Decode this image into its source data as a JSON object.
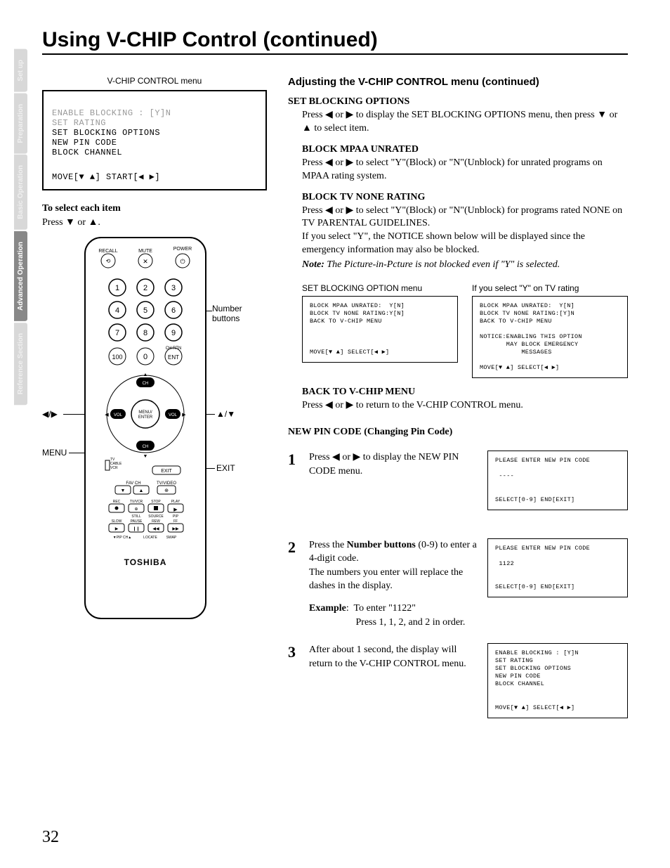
{
  "title": "Using V-CHIP Control (continued)",
  "page_number": "32",
  "side_tabs": [
    {
      "label": "Set up",
      "active": false
    },
    {
      "label": "Preparation",
      "active": false
    },
    {
      "label": "Basic Operation",
      "active": false
    },
    {
      "label": "Advanced Operation",
      "active": true
    },
    {
      "label": "Reference Section",
      "active": false
    }
  ],
  "left": {
    "menu_title": "V-CHIP CONTROL menu",
    "vchip_menu": {
      "line1": "ENABLE BLOCKING : [Y]N",
      "line2": "SET RATING",
      "line3": "SET BLOCKING OPTIONS",
      "line4": "NEW PIN CODE",
      "line5": "BLOCK CHANNEL",
      "footer": "MOVE[▼ ▲] START[◀ ▶]"
    },
    "select_head": "To select each item",
    "select_text": "Press ▼ or ▲.",
    "callouts": {
      "left_arrows": "◀/▶",
      "menu": "MENU",
      "number": "Number\nbuttons",
      "up_down": "▲/▼",
      "exit": "EXIT"
    },
    "remote": {
      "top_labels": {
        "recall": "RECALL",
        "mute": "MUTE",
        "power": "POWER"
      },
      "numbers": [
        "1",
        "2",
        "3",
        "4",
        "5",
        "6",
        "7",
        "8",
        "9",
        "100",
        "0",
        "ENT"
      ],
      "channel": "CH",
      "vol": "VOL",
      "menu": "MENU/\nENTER",
      "tv_cable": "TV\nCABLE\nVCR",
      "exit": "EXIT",
      "row1": {
        "favch": "FAV CH",
        "tvvideo": "TV/VIDEO"
      },
      "row2": {
        "rec": "REC",
        "tvvcr": "TV/VCR",
        "stop": "STOP",
        "play": "PLAY"
      },
      "row3": {
        "slow": "SLOW",
        "pause": "PAUSE",
        "rew": "REW",
        "ff": "FF",
        "still": "STILL",
        "source": "SOURCE",
        "pip": "PIP"
      },
      "row4": {
        "pipch": "▼PIP CH▲",
        "locate": "LOCATE",
        "swap": "SWAP"
      },
      "brand": "TOSHIBA"
    }
  },
  "right": {
    "section_title": "Adjusting the V-CHIP CONTROL menu (continued)",
    "set_blocking": {
      "head": "SET BLOCKING OPTIONS",
      "text": "Press ◀ or ▶ to display the SET BLOCKING OPTIONS menu, then press ▼ or ▲ to select item."
    },
    "block_mpaa": {
      "head": "BLOCK MPAA UNRATED",
      "text": "Press ◀ or ▶ to select \"Y\"(Block) or \"N\"(Unblock) for unrated programs on MPAA rating system."
    },
    "block_tv": {
      "head": "BLOCK TV NONE RATING",
      "text1": "Press ◀ or ▶ to select \"Y\"(Block) or \"N\"(Unblock) for programs rated NONE on TV PARENTAL GUIDELINES.",
      "text2": "If you select \"Y\", the NOTICE shown below will be displayed since the emergency information may also be blocked.",
      "note": "Note: The Picture-in-Pcture is not blocked even if \"Y\" is selected."
    },
    "menu_labels": {
      "left": "SET BLOCKING OPTION menu",
      "right": "If you select \"Y\" on TV rating"
    },
    "sbo_menu_left": "BLOCK MPAA UNRATED:  Y[N]\nBLOCK TV NONE RATING:Y[N]\nBACK TO V-CHIP MENU\n\n\n\nMOVE[▼ ▲] SELECT[◀ ▶]",
    "sbo_menu_right": "BLOCK MPAA UNRATED:  Y[N]\nBLOCK TV NONE RATING:[Y]N\nBACK TO V-CHIP MENU\n\nNOTICE:ENABLING THIS OPTION\n       MAY BLOCK EMERGENCY\n           MESSAGES\n\nMOVE[▼ ▲] SELECT[◀ ▶]",
    "back_menu": {
      "head": "BACK TO V-CHIP MENU",
      "text": "Press ◀ or ▶ to return to the V-CHIP CONTROL menu."
    },
    "new_pin_head": "NEW PIN CODE (Changing Pin Code)",
    "steps": [
      {
        "num": "1",
        "text": "Press  ◀ or ▶  to display the NEW PIN CODE menu.",
        "menu": "PLEASE ENTER NEW PIN CODE\n\n ----\n\n\nSELECT[0-9] END[EXIT]"
      },
      {
        "num": "2",
        "text_pre": "Press the ",
        "text_bold": "Number buttons",
        "text_post": " (0-9) to enter a 4-digit code.\nThe numbers you enter will replace the dashes in the display.",
        "example_label": "Example",
        "example": ":  To enter \"1122\"\n                   Press 1, 1, 2, and 2 in order.",
        "menu": "PLEASE ENTER NEW PIN CODE\n\n 1122\n\n\nSELECT[0-9] END[EXIT]"
      },
      {
        "num": "3",
        "text": "After about 1 second, the display will return to the V-CHIP CONTROL menu.",
        "menu": "ENABLE BLOCKING : [Y]N\nSET RATING\nSET BLOCKING OPTIONS\nNEW PIN CODE\nBLOCK CHANNEL\n\n\nMOVE[▼ ▲] SELECT[◀ ▶]"
      }
    ]
  }
}
